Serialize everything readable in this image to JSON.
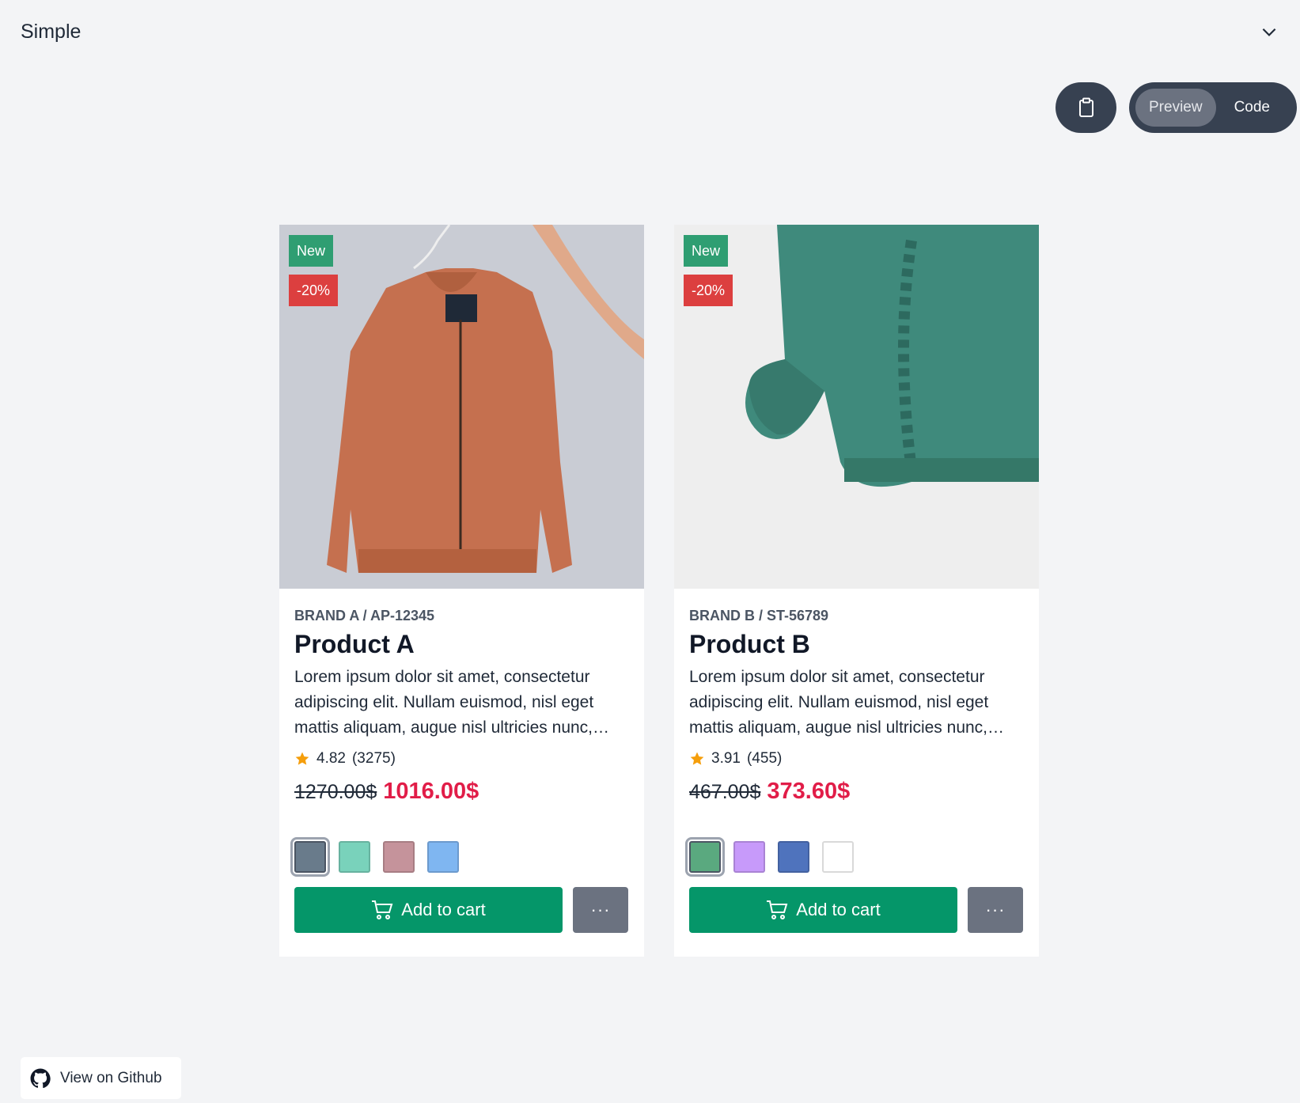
{
  "header": {
    "title": "Simple",
    "toggle_icon": "chevron-down-icon"
  },
  "toolbar": {
    "copy_icon": "clipboard-icon",
    "preview_label": "Preview",
    "code_label": "Code",
    "active": "Preview"
  },
  "products": [
    {
      "badge_new": "New",
      "badge_discount": "-20%",
      "brand": "BRAND A / AP-12345",
      "name": "Product A",
      "description": "Lorem ipsum dolor sit amet, consectetur adipiscing elit. Nullam euismod, nisl eget mattis aliquam, augue nisl ultricies nunc,…",
      "rating": "4.82",
      "reviews": "(3275)",
      "old_price": "1270.00$",
      "price": "1016.00$",
      "swatches": [
        "#697b8b",
        "#79d2bb",
        "#c5939b",
        "#7fb6f1"
      ],
      "selected_swatch": 0,
      "add_label": "Add to cart",
      "more_label": "···",
      "image": "orange-bomber-jacket-photo"
    },
    {
      "badge_new": "New",
      "badge_discount": "-20%",
      "brand": "BRAND B / ST-56789",
      "name": "Product B",
      "description": "Lorem ipsum dolor sit amet, consectetur adipiscing elit. Nullam euismod, nisl eget mattis aliquam, augue nisl ultricies nunc,…",
      "rating": "3.91",
      "reviews": "(455)",
      "old_price": "467.00$",
      "price": "373.60$",
      "swatches": [
        "#5aa97f",
        "#c79afa",
        "#4f73bd",
        "#ffffff"
      ],
      "selected_swatch": 0,
      "add_label": "Add to cart",
      "more_label": "···",
      "image": "green-knit-sweater-photo"
    }
  ],
  "footer": {
    "github_label": "View on Github",
    "github_icon": "github-icon"
  }
}
